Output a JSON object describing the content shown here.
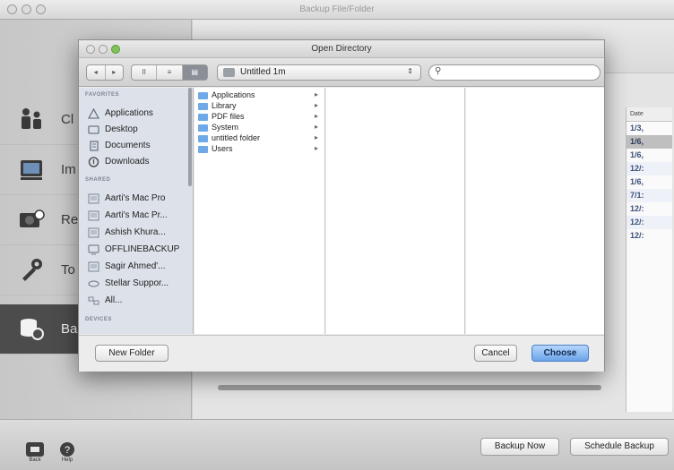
{
  "app": {
    "title": "Backup File/Folder",
    "sidebar": [
      {
        "label": "Cl",
        "icon": "people-icon",
        "active": false
      },
      {
        "label": "Im",
        "icon": "disk-image-icon",
        "active": false
      },
      {
        "label": "Re",
        "icon": "drive-restore-icon",
        "active": false
      },
      {
        "label": "To",
        "icon": "tools-icon",
        "active": false
      },
      {
        "label": "Ba",
        "icon": "database-backup-icon",
        "active": true
      }
    ],
    "date_column": {
      "header": "Date",
      "cells": [
        "1/3,",
        "1/6,",
        "1/6,",
        "12/:",
        "1/6,",
        "7/1:",
        "12/:",
        "12/:",
        "12/:"
      ]
    },
    "bottom": {
      "back_label": "Back",
      "help_label": "Help",
      "backup_now": "Backup Now",
      "schedule_backup": "Schedule Backup"
    }
  },
  "dialog": {
    "title": "Open Directory",
    "view_modes": [
      "II",
      "≡",
      "▤"
    ],
    "nav": [
      "◂",
      "▸"
    ],
    "location": "Untitled 1m",
    "search_placeholder": "",
    "sidebar": {
      "favorites_heading": "FAVORITES",
      "favorites": [
        {
          "label": "Applications",
          "icon": "applications-icon"
        },
        {
          "label": "Desktop",
          "icon": "desktop-icon"
        },
        {
          "label": "Documents",
          "icon": "documents-icon"
        },
        {
          "label": "Downloads",
          "icon": "downloads-icon"
        }
      ],
      "shared_heading": "SHARED",
      "shared": [
        {
          "label": "Aarti's Mac Pro",
          "icon": "computer-icon"
        },
        {
          "label": "Aarti's Mac Pr...",
          "icon": "computer-icon"
        },
        {
          "label": "Ashish Khura...",
          "icon": "computer-icon"
        },
        {
          "label": "OFFLINEBACKUP",
          "icon": "display-icon"
        },
        {
          "label": "Sagir Ahmed'...",
          "icon": "computer-icon"
        },
        {
          "label": "Stellar Suppor...",
          "icon": "network-icon"
        },
        {
          "label": "All...",
          "icon": "network-all-icon"
        }
      ],
      "devices_heading": "DEVICES"
    },
    "files": [
      {
        "label": "Applications"
      },
      {
        "label": "Library"
      },
      {
        "label": "PDF files"
      },
      {
        "label": "System"
      },
      {
        "label": "untitled folder"
      },
      {
        "label": "Users"
      }
    ],
    "buttons": {
      "new_folder": "New Folder",
      "cancel": "Cancel",
      "choose": "Choose"
    }
  }
}
